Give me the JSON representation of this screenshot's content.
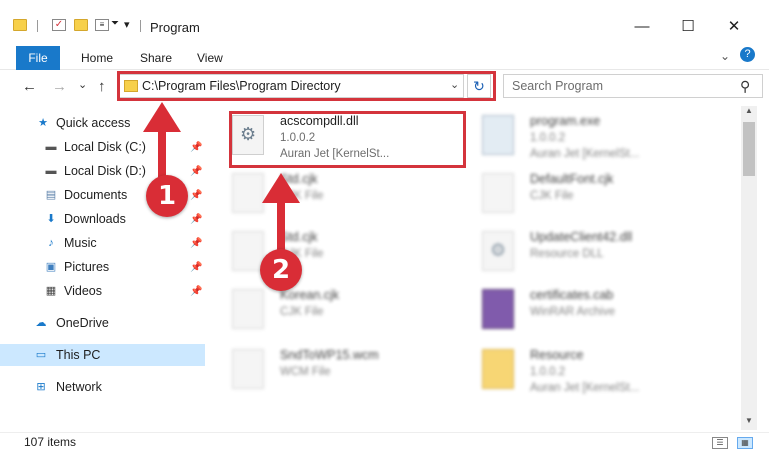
{
  "window": {
    "title": "Program",
    "controls": {
      "minimize": "—",
      "maximize": "☐",
      "close": "✕"
    }
  },
  "ribbon": {
    "tabs": [
      "File",
      "Home",
      "Share",
      "View"
    ],
    "expand_icon": "chevron-down-icon",
    "help_icon": "question-icon"
  },
  "nav": {
    "back": "←",
    "forward": "→",
    "recent": "⌄",
    "up": "↑",
    "address": "C:\\Program Files\\Program Directory",
    "search_placeholder": "Search Program"
  },
  "sidebar": {
    "items": [
      {
        "label": "Quick access",
        "icon": "star-icon",
        "pinned": false
      },
      {
        "label": "Local Disk (C:)",
        "icon": "drive-icon",
        "pinned": true
      },
      {
        "label": "Local Disk (D:)",
        "icon": "drive-icon",
        "pinned": true
      },
      {
        "label": "Documents",
        "icon": "documents-icon",
        "pinned": true
      },
      {
        "label": "Downloads",
        "icon": "download-icon",
        "pinned": true
      },
      {
        "label": "Music",
        "icon": "music-icon",
        "pinned": true
      },
      {
        "label": "Pictures",
        "icon": "pictures-icon",
        "pinned": true
      },
      {
        "label": "Videos",
        "icon": "videos-icon",
        "pinned": true
      },
      {
        "label": "OneDrive",
        "icon": "cloud-icon",
        "pinned": false
      },
      {
        "label": "This PC",
        "icon": "computer-icon",
        "pinned": false,
        "selected": true
      },
      {
        "label": "Network",
        "icon": "network-icon",
        "pinned": false
      }
    ]
  },
  "files": [
    {
      "name": "acscompdll.dll",
      "line1": "1.0.0.2",
      "line2": "Auran Jet [KernelSt...",
      "icon": "dll",
      "blurred": false
    },
    {
      "name": "program.exe",
      "line1": "1.0.0.2",
      "line2": "Auran Jet [KernelSt...",
      "icon": "exe",
      "blurred": true
    },
    {
      "name": "Std.cjk",
      "line1": "CJK File",
      "line2": "",
      "icon": "doc",
      "blurred": true
    },
    {
      "name": "DefaultFont.cjk",
      "line1": "CJK File",
      "line2": "",
      "icon": "doc",
      "blurred": true
    },
    {
      "name": "Std.cjk",
      "line1": "CJK File",
      "line2": "",
      "icon": "doc",
      "blurred": true
    },
    {
      "name": "UpdateClient42.dll",
      "line1": "Resource DLL",
      "line2": "",
      "icon": "dll",
      "blurred": true
    },
    {
      "name": "Korean.cjk",
      "line1": "CJK File",
      "line2": "",
      "icon": "doc",
      "blurred": true
    },
    {
      "name": "certificates.cab",
      "line1": "WinRAR Archive",
      "line2": "",
      "icon": "rar",
      "blurred": true
    },
    {
      "name": "SndToWP15.wcm",
      "line1": "WCM File",
      "line2": "",
      "icon": "doc",
      "blurred": true
    },
    {
      "name": "Resource",
      "line1": "1.0.0.2",
      "line2": "Auran Jet [KernelSt...",
      "icon": "folder",
      "blurred": true
    }
  ],
  "annotations": {
    "step1": "1",
    "step2": "2"
  },
  "status": {
    "item_count": "107 items"
  },
  "colors": {
    "accent": "#1979ca",
    "highlight": "#d4343c",
    "selected": "#cce8ff"
  }
}
